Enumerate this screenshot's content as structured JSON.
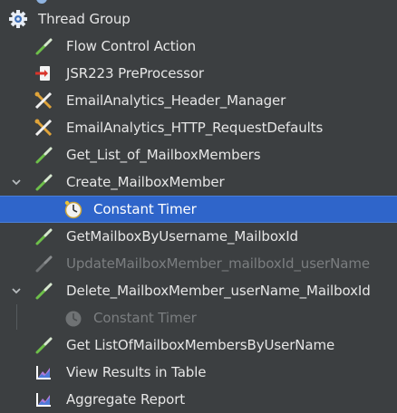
{
  "tree": {
    "top_partial_label": "",
    "items": [
      {
        "label": "Thread Group",
        "icon": "gear-icon"
      },
      {
        "label": "Flow Control Action",
        "icon": "pipette-icon"
      },
      {
        "label": "JSR223 PreProcessor",
        "icon": "preprocessor-icon"
      },
      {
        "label": "EmailAnalytics_Header_Manager",
        "icon": "wrench-scissors-icon"
      },
      {
        "label": "EmailAnalytics_HTTP_RequestDefaults",
        "icon": "wrench-scissors-icon"
      },
      {
        "label": "Get_List_of_MailboxMembers",
        "icon": "pipette-icon"
      },
      {
        "label": "Create_MailboxMember",
        "icon": "pipette-icon",
        "expanded": true
      },
      {
        "label": "Constant Timer",
        "icon": "timer-icon",
        "selected": true
      },
      {
        "label": "GetMailboxByUsername_MailboxId",
        "icon": "pipette-icon"
      },
      {
        "label": "UpdateMailboxMember_mailboxId_userName",
        "icon": "pipette-icon",
        "disabled": true
      },
      {
        "label": "Delete_MailboxMember_userName_MailboxId",
        "icon": "pipette-icon",
        "expanded": true
      },
      {
        "label": "Constant Timer",
        "icon": "timer-icon",
        "disabled": true
      },
      {
        "label": "Get ListOfMailboxMembersByUserName",
        "icon": "pipette-icon"
      },
      {
        "label": "View Results in Table",
        "icon": "chart-icon"
      },
      {
        "label": "Aggregate Report",
        "icon": "chart-icon"
      }
    ]
  },
  "colors": {
    "background": "#3c3f41",
    "selected": "#2f65ca",
    "text": "#e6e6e6",
    "disabled_text": "#7b7e80"
  }
}
